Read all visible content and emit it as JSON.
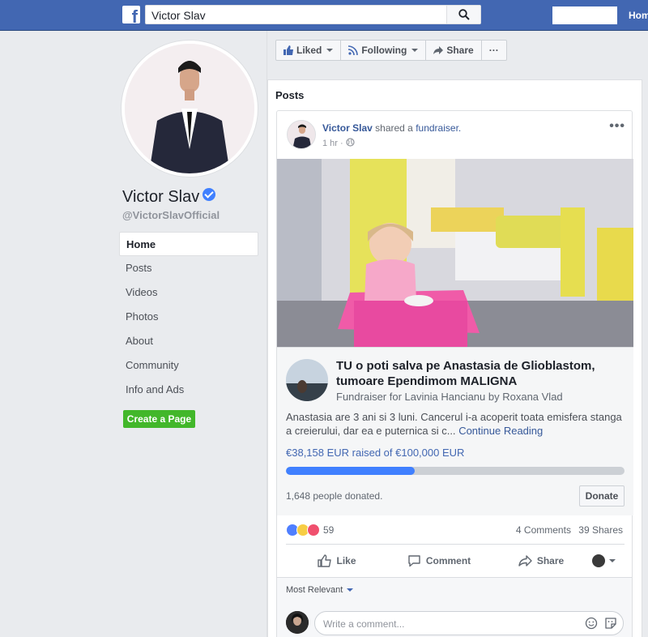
{
  "topbar": {
    "search_value": "Victor Slav",
    "home_label": "Home",
    "logo_letter": "f"
  },
  "profile": {
    "name": "Victor Slav",
    "handle": "@VictorSlavOfficial"
  },
  "nav": {
    "items": [
      {
        "label": "Home",
        "active": true
      },
      {
        "label": "Posts"
      },
      {
        "label": "Videos"
      },
      {
        "label": "Photos"
      },
      {
        "label": "About"
      },
      {
        "label": "Community"
      },
      {
        "label": "Info and Ads"
      }
    ],
    "create_page": "Create a Page"
  },
  "actions": {
    "liked": "Liked",
    "following": "Following",
    "share": "Share",
    "more": "···"
  },
  "posts": {
    "title": "Posts",
    "post": {
      "author": "Victor Slav",
      "verb": "shared a",
      "object": "fundraiser.",
      "time": "1 hr ·",
      "menu": "•••",
      "fundraiser": {
        "title": "TU o poti salva pe Anastasia de Glioblastom, tumoare Ependimom MALIGNA",
        "sub": "Fundraiser for Lavinia Hancianu by Roxana Vlad",
        "desc": "Anastasia are 3 ani si 3 luni. Cancerul i-a acoperit toata emisfera stanga a creierului, dar ea e puternica si c...",
        "continue": "Continue Reading",
        "raised": "€38,158 EUR raised of €100,000 EUR",
        "progress": 0.38,
        "donated": "1,648 people donated.",
        "donate": "Donate"
      },
      "reactions_count": "59",
      "comments": "4 Comments",
      "shares": "39 Shares",
      "like": "Like",
      "comment": "Comment",
      "share": "Share",
      "most_relevant": "Most Relevant",
      "comment_placeholder": "Write a comment..."
    }
  },
  "colors": {
    "brand": "#4267b2",
    "progress": "#4080ff",
    "create": "#42b72a"
  }
}
